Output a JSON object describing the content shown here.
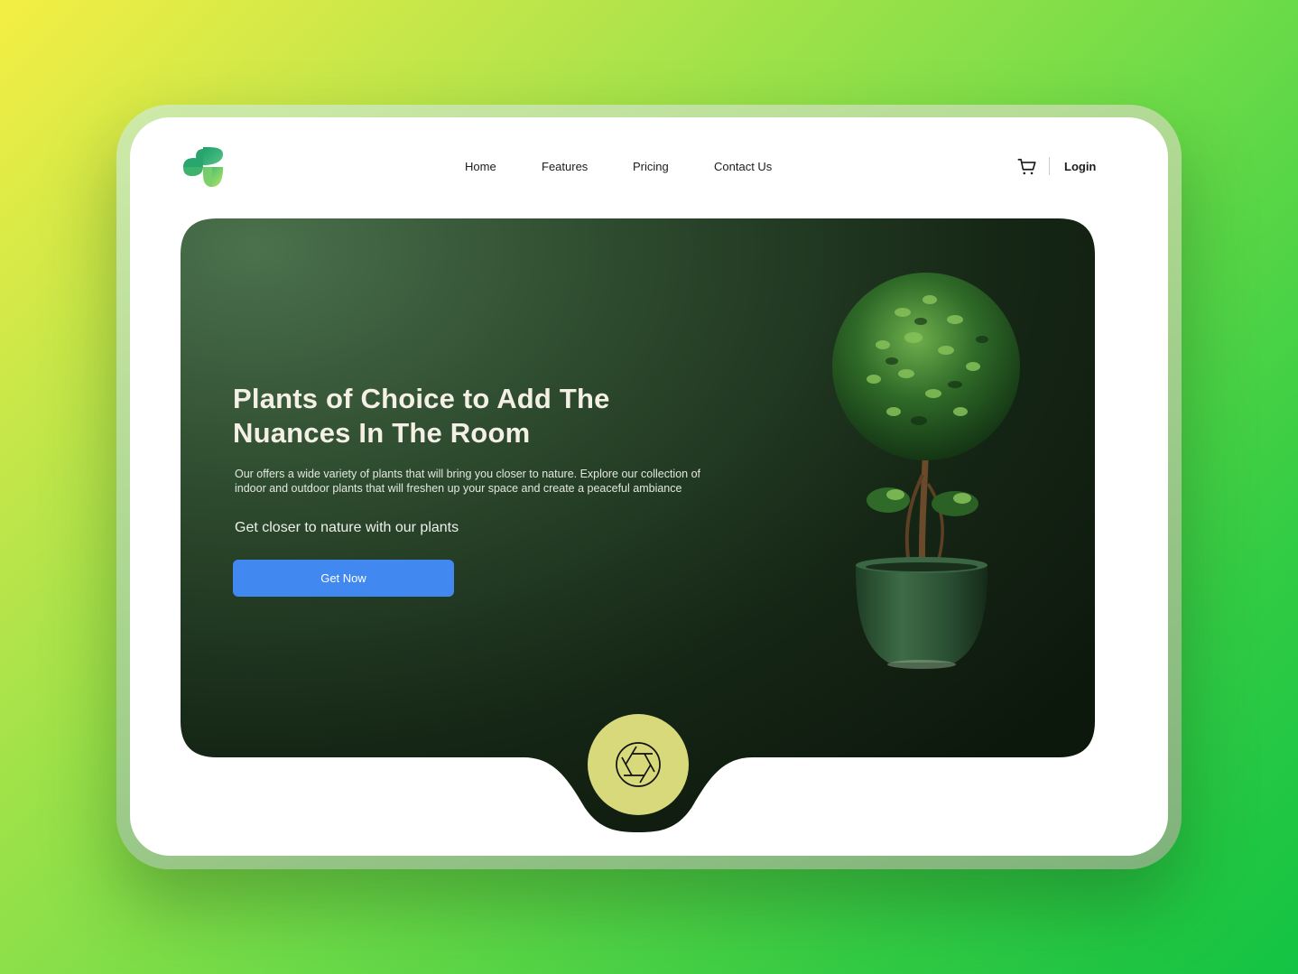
{
  "header": {
    "logo_icon": "clover-logo-icon",
    "nav": [
      {
        "label": "Home"
      },
      {
        "label": "Features"
      },
      {
        "label": "Pricing"
      },
      {
        "label": "Contact Us"
      }
    ],
    "cart_icon": "cart-icon",
    "login_label": "Login"
  },
  "hero": {
    "title": "Plants of Choice to Add The Nuances In The Room",
    "description": "Our offers a wide variety of plants that will bring you closer to nature. Explore our collection of indoor and outdoor plants that will freshen up your space and create a peaceful ambiance",
    "tagline": "Get closer to nature with our plants",
    "cta_label": "Get Now",
    "image_icon": "potted-plant-image",
    "camera_icon": "camera-aperture-icon"
  },
  "colors": {
    "hero_dark": "#0f1d0f",
    "hero_light": "#4a6f4a",
    "cta_blue": "#4189f0",
    "camera_yellow": "#d7d97a"
  }
}
